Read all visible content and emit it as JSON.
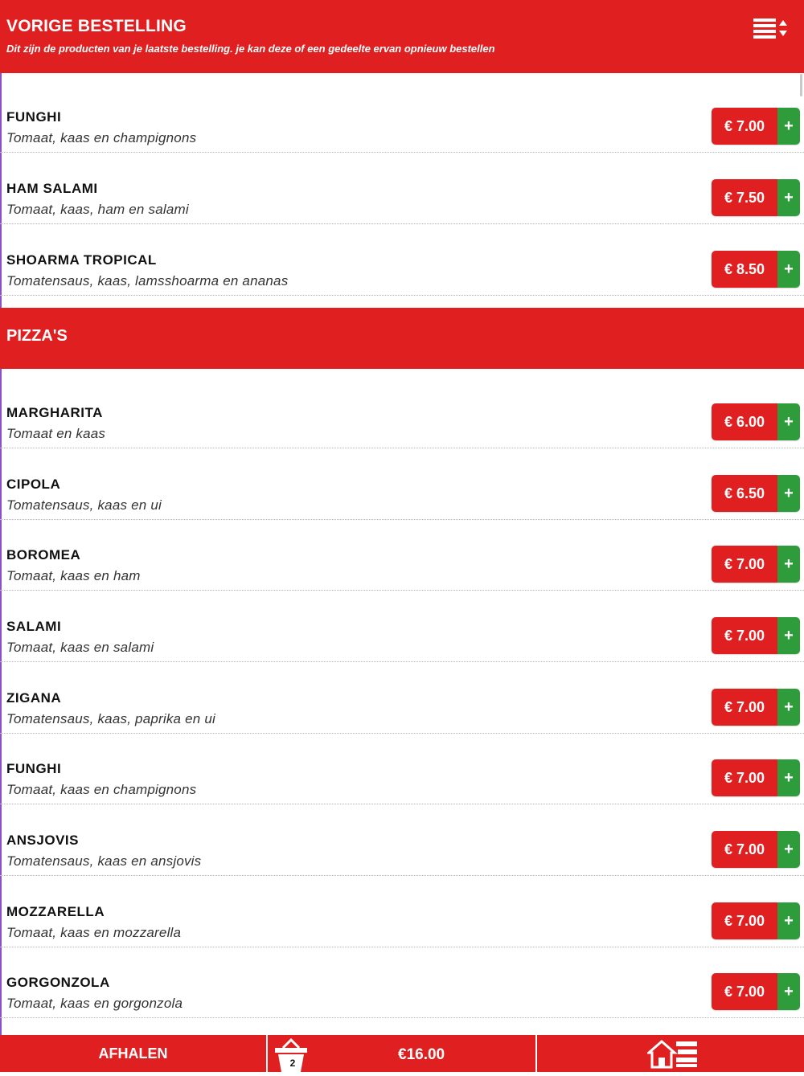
{
  "previous_order": {
    "title": "VORIGE BESTELLING",
    "subtitle": "Dit zijn de producten van je laatste bestelling. je kan deze of een gedeelte ervan opnieuw bestellen",
    "items": [
      {
        "name": "FUNGHI",
        "desc": "Tomaat, kaas en champignons",
        "price": "€ 7.00",
        "add": "+"
      },
      {
        "name": "HAM SALAMI",
        "desc": "Tomaat, kaas, ham en salami",
        "price": "€ 7.50",
        "add": "+"
      },
      {
        "name": "SHOARMA TROPICAL",
        "desc": "Tomatensaus, kaas, lamsshoarma en ananas",
        "price": "€ 8.50",
        "add": "+"
      }
    ]
  },
  "pizzas": {
    "title": "PIZZA'S",
    "items": [
      {
        "name": "MARGHARITA",
        "desc": "Tomaat en kaas",
        "price": "€ 6.00",
        "add": "+"
      },
      {
        "name": "CIPOLA",
        "desc": "Tomatensaus, kaas en ui",
        "price": "€ 6.50",
        "add": "+"
      },
      {
        "name": "BOROMEA",
        "desc": "Tomaat, kaas en ham",
        "price": "€ 7.00",
        "add": "+"
      },
      {
        "name": "SALAMI",
        "desc": "Tomaat, kaas en salami",
        "price": "€ 7.00",
        "add": "+"
      },
      {
        "name": "ZIGANA",
        "desc": "Tomatensaus, kaas, paprika en ui",
        "price": "€ 7.00",
        "add": "+"
      },
      {
        "name": "FUNGHI",
        "desc": "Tomaat, kaas en champignons",
        "price": "€ 7.00",
        "add": "+"
      },
      {
        "name": "ANSJOVIS",
        "desc": "Tomatensaus, kaas en ansjovis",
        "price": "€ 7.00",
        "add": "+"
      },
      {
        "name": "MOZZARELLA",
        "desc": "Tomaat, kaas en mozzarella",
        "price": "€ 7.00",
        "add": "+"
      },
      {
        "name": "GORGONZOLA",
        "desc": "Tomaat, kaas en gorgonzola",
        "price": "€ 7.00",
        "add": "+"
      }
    ]
  },
  "footer": {
    "pickup_label": "AFHALEN",
    "cart_count": "2",
    "cart_total": "€16.00"
  },
  "icons": {
    "menu": "sort-menu-icon",
    "cart": "basket-icon",
    "home": "home-menu-icon"
  },
  "colors": {
    "primary_red": "#e02020",
    "add_green": "#2f9c3c"
  }
}
